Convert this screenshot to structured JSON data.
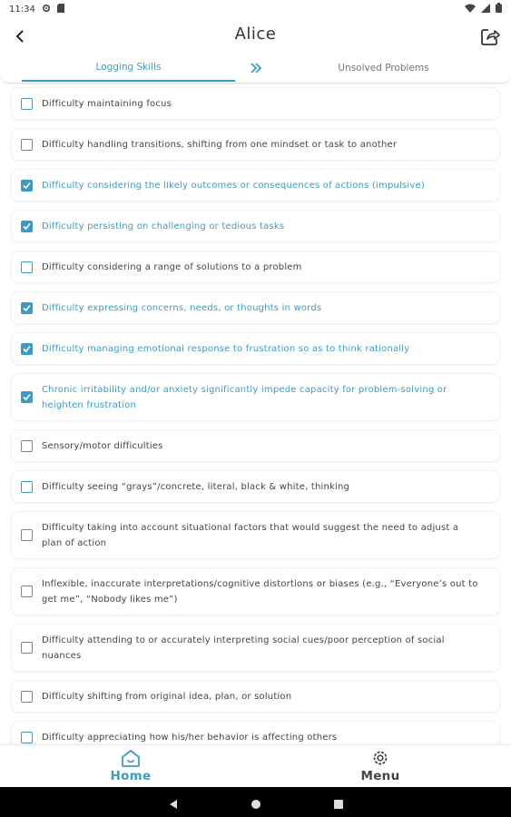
{
  "status_bar": {
    "time": "11:34"
  },
  "header": {
    "title": "Alice"
  },
  "tabs": {
    "logging": "Logging Skills",
    "unsolved": "Unsolved Problems"
  },
  "skills": [
    {
      "label": "Difficulty maintaining focus",
      "checked": false
    },
    {
      "label": "Difficulty handling transitions, shifting from one mindset or task to another",
      "checked": false
    },
    {
      "label": "Difficulty considering the likely outcomes or consequences of actions (impulsive)",
      "checked": true
    },
    {
      "label": "Difficulty persisting on challenging or tedious tasks",
      "checked": true
    },
    {
      "label": "Difficulty considering a range of solutions to a problem",
      "checked": false
    },
    {
      "label": "Difficulty expressing concerns, needs, or thoughts in words",
      "checked": true
    },
    {
      "label": "Difficulty managing emotional response to frustration so as to think rationally",
      "checked": true
    },
    {
      "label": "Chronic irritability and/or anxiety significantly impede capacity for problem-solving or heighten frustration",
      "checked": true
    },
    {
      "label": "Sensory/motor difficulties",
      "checked": false
    },
    {
      "label": "Difficulty seeing “grays”/concrete, literal, black & white, thinking",
      "checked": false
    },
    {
      "label": "Difficulty taking into account situational factors that would suggest the need to adjust a plan of action",
      "checked": false
    },
    {
      "label": "Inflexible, inaccurate interpretations/cognitive distortions or biases (e.g., “Everyone’s out to get me”, “Nobody likes me”)",
      "checked": false
    },
    {
      "label": "Difficulty attending to or accurately interpreting social cues/poor perception of social nuances",
      "checked": false
    },
    {
      "label": "Difficulty shifting from original idea, plan, or solution",
      "checked": false
    },
    {
      "label": "Difficulty appreciating how his/her behavior is affecting others",
      "checked": false
    }
  ],
  "bottom_nav": {
    "home": "Home",
    "menu": "Menu"
  },
  "colors": {
    "accent": "#3a9cc5",
    "text": "#444444"
  }
}
